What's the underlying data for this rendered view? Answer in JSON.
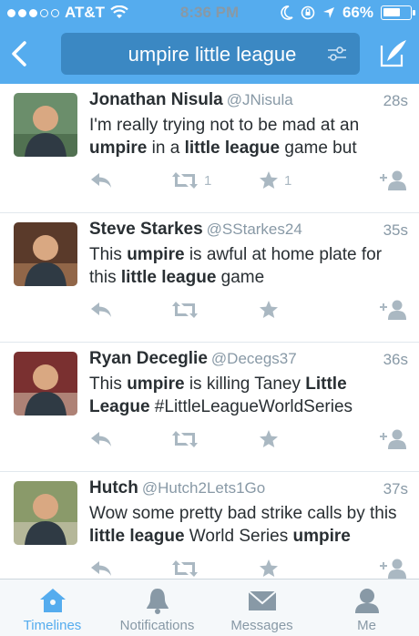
{
  "status": {
    "carrier": "AT&T",
    "time": "8:36 PM",
    "battery": "66%",
    "battery_level": 0.66
  },
  "header": {
    "query": "umpire little league"
  },
  "tweets": [
    {
      "name": "Jonathan Nisula",
      "handle": "@JNisula",
      "time": "28s",
      "text": [
        [
          "I'm really trying not to be mad at an ",
          false
        ],
        [
          "umpire",
          true
        ],
        [
          " in a ",
          false
        ],
        [
          "little league",
          true
        ],
        [
          " game but",
          false
        ]
      ],
      "retweets": "1",
      "favorites": "1",
      "avatar_colors": [
        "#6b8e6b",
        "#3d5a3d"
      ]
    },
    {
      "name": "Steve Starkes",
      "handle": "@SStarkes24",
      "time": "35s",
      "text": [
        [
          "This ",
          false
        ],
        [
          "umpire",
          true
        ],
        [
          " is awful at home plate for this ",
          false
        ],
        [
          "little league",
          true
        ],
        [
          " game",
          false
        ]
      ],
      "retweets": "",
      "favorites": "",
      "avatar_colors": [
        "#5a3a2a",
        "#c08a60"
      ]
    },
    {
      "name": "Ryan Deceglie",
      "handle": "@Decegs37",
      "time": "36s",
      "text": [
        [
          "This ",
          false
        ],
        [
          "umpire",
          true
        ],
        [
          " is killing Taney ",
          false
        ],
        [
          "Little League",
          true
        ],
        [
          " #LittleLeagueWorldSeries",
          false
        ]
      ],
      "retweets": "",
      "favorites": "",
      "avatar_colors": [
        "#7a3030",
        "#d9c7b0"
      ]
    },
    {
      "name": "Hutch",
      "handle": "@Hutch2Lets1Go",
      "time": "37s",
      "text": [
        [
          "Wow some pretty bad strike calls by this ",
          false
        ],
        [
          "little league",
          true
        ],
        [
          " World Series ",
          false
        ],
        [
          "umpire",
          true
        ]
      ],
      "retweets": "",
      "favorites": "",
      "avatar_colors": [
        "#8a9a6a",
        "#d8d0c0"
      ]
    }
  ],
  "tabs": [
    {
      "label": "Timelines",
      "icon": "home-icon",
      "active": true
    },
    {
      "label": "Notifications",
      "icon": "bell-icon",
      "active": false
    },
    {
      "label": "Messages",
      "icon": "envelope-icon",
      "active": false
    },
    {
      "label": "Me",
      "icon": "person-icon",
      "active": false
    }
  ],
  "colors": {
    "brand": "#55acee",
    "action_gray": "#aab8c2"
  }
}
